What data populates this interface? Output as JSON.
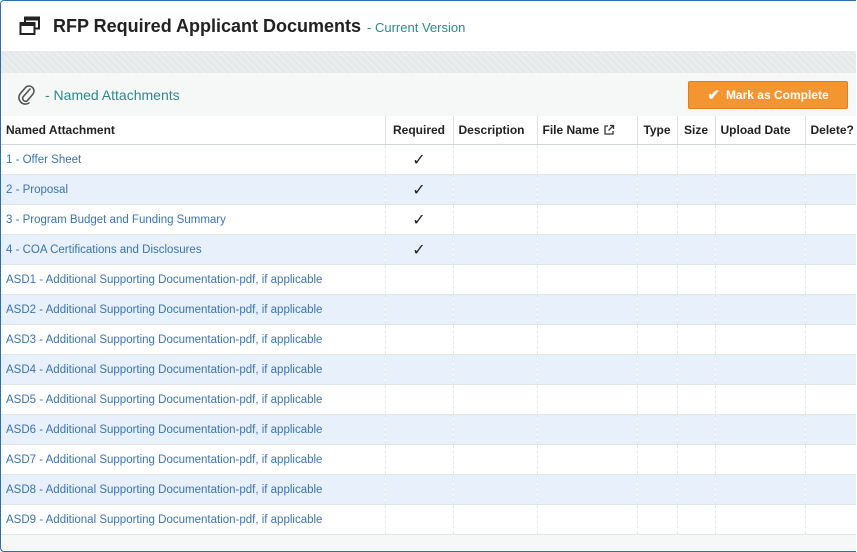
{
  "header": {
    "title": "RFP Required Applicant Documents",
    "subtitle": "- Current Version",
    "icon": "window-restore-icon"
  },
  "attachments_bar": {
    "label": "- Named Attachments",
    "icon": "paperclip-icon",
    "complete_button": "Mark as Complete",
    "button_color": "#f39530"
  },
  "table": {
    "headers": {
      "named_attachment": "Named Attachment",
      "required": "Required",
      "description": "Description",
      "file_name": "File Name",
      "type": "Type",
      "size": "Size",
      "upload_date": "Upload Date",
      "delete": "Delete?"
    },
    "rows": [
      {
        "name": "1 - Offer Sheet",
        "required": "✓"
      },
      {
        "name": "2 - Proposal",
        "required": "✓"
      },
      {
        "name": "3 - Program Budget and Funding Summary",
        "required": "✓"
      },
      {
        "name": "4 - COA Certifications and Disclosures",
        "required": "✓"
      },
      {
        "name": "ASD1 - Additional Supporting Documentation-pdf, if applicable",
        "required": ""
      },
      {
        "name": "ASD2 - Additional Supporting Documentation-pdf, if applicable",
        "required": ""
      },
      {
        "name": "ASD3 - Additional Supporting Documentation-pdf, if applicable",
        "required": ""
      },
      {
        "name": "ASD4 - Additional Supporting Documentation-pdf, if applicable",
        "required": ""
      },
      {
        "name": "ASD5 - Additional Supporting Documentation-pdf, if applicable",
        "required": ""
      },
      {
        "name": "ASD6 - Additional Supporting Documentation-pdf, if applicable",
        "required": ""
      },
      {
        "name": "ASD7 - Additional Supporting Documentation-pdf, if applicable",
        "required": ""
      },
      {
        "name": "ASD8 - Additional Supporting Documentation-pdf, if applicable",
        "required": ""
      },
      {
        "name": "ASD9 - Additional Supporting Documentation-pdf, if applicable",
        "required": ""
      }
    ]
  },
  "colors": {
    "link": "#3b74b4",
    "accent_teal": "#2e8a8a",
    "row_alt": "#e8f0fb",
    "frame_border": "#2a6fb0"
  }
}
